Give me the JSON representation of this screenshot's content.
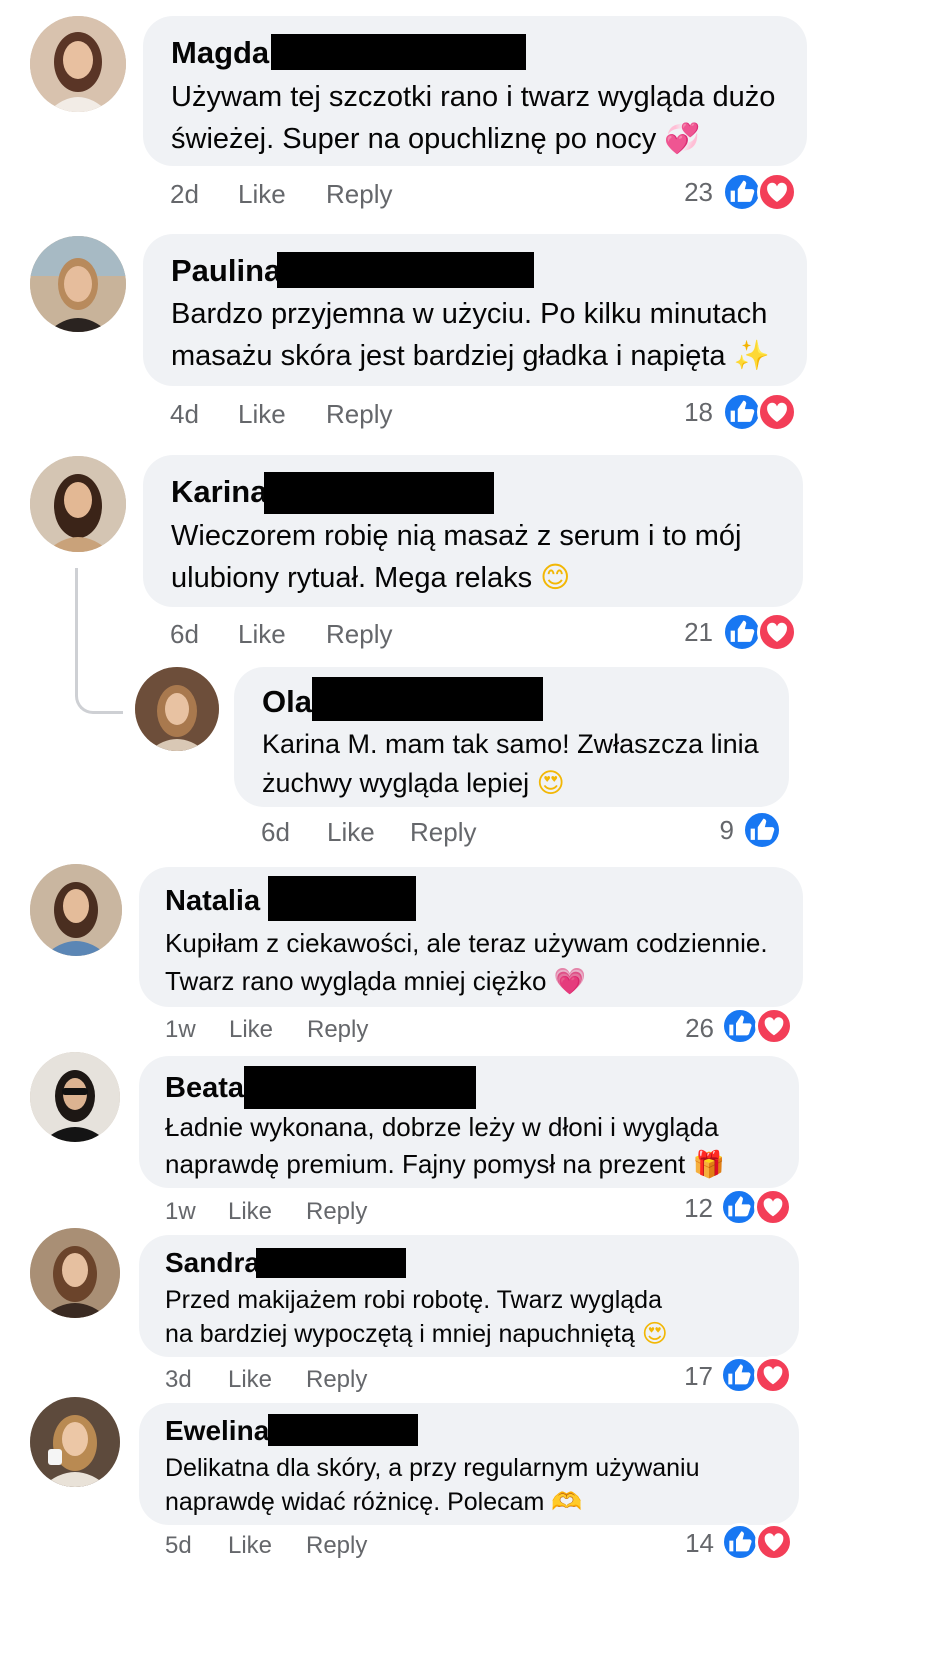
{
  "comments": [
    {
      "name": "Magda",
      "text_line1": "Używam tej szczotki rano i twarz wygląda dużo",
      "text_line2": "świeżej. Super na opuchliznę po nocy",
      "emoji": "💞",
      "emoji_name": "two-hearts-emoji",
      "time": "2d",
      "like": "Like",
      "reply": "Reply",
      "count": "23",
      "reactions": [
        "like",
        "love"
      ]
    },
    {
      "name": "Paulina",
      "text_line1": "Bardzo przyjemna w użyciu. Po kilku minutach",
      "text_line2": "masażu skóra jest bardziej gładka i napięta",
      "emoji": "✨",
      "emoji_name": "sparkles-emoji",
      "time": "4d",
      "like": "Like",
      "reply": "Reply",
      "count": "18",
      "reactions": [
        "like",
        "love"
      ]
    },
    {
      "name": "Karina",
      "text_line1": "Wieczorem robię nią masaż z serum i to mój",
      "text_line2": "ulubiony rytuał. Mega relaks",
      "emoji": "😊",
      "emoji_name": "smiling-face-emoji",
      "time": "6d",
      "like": "Like",
      "reply": "Reply",
      "count": "21",
      "reactions": [
        "like",
        "love"
      ]
    },
    {
      "name": "Ola",
      "text_line1": "Karina M. mam tak samo! Zwłaszcza linia",
      "text_line2": "żuchwy wygląda lepiej",
      "emoji": "😍",
      "emoji_name": "heart-eyes-emoji",
      "time": "6d",
      "like": "Like",
      "reply": "Reply",
      "count": "9",
      "reactions": [
        "like"
      ]
    },
    {
      "name": "Natalia",
      "text_line1": "Kupiłam z ciekawości, ale teraz używam codziennie.",
      "text_line2": "Twarz rano wygląda mniej ciężko",
      "emoji": "💗",
      "emoji_name": "growing-heart-emoji",
      "time": "1w",
      "like": "Like",
      "reply": "Reply",
      "count": "26",
      "reactions": [
        "like",
        "love"
      ]
    },
    {
      "name": "Beata",
      "text_line1": "Ładnie wykonana, dobrze leży w dłoni i wygląda",
      "text_line2": "naprawdę premium. Fajny pomysł na prezent",
      "emoji": "🎁",
      "emoji_name": "gift-emoji",
      "time": "1w",
      "like": "Like",
      "reply": "Reply",
      "count": "12",
      "reactions": [
        "like",
        "love"
      ]
    },
    {
      "name": "Sandra",
      "text_line1": "Przed makijażem robi robotę. Twarz wygląda",
      "text_line2": "na bardziej wypoczętą i mniej napuchniętą",
      "emoji": "😍",
      "emoji_name": "heart-eyes-emoji",
      "time": "3d",
      "like": "Like",
      "reply": "Reply",
      "count": "17",
      "reactions": [
        "like",
        "love"
      ]
    },
    {
      "name": "Ewelina",
      "text_line1": "Delikatna dla skóry, a przy regularnym używaniu",
      "text_line2": "naprawdę widać różnicę. Polecam",
      "emoji": "🫶",
      "emoji_name": "heart-hands-emoji",
      "time": "5d",
      "like": "Like",
      "reply": "Reply",
      "count": "14",
      "reactions": [
        "like",
        "love"
      ]
    }
  ],
  "colors": {
    "bubble": "#f0f2f5",
    "meta": "#65676b",
    "like_blue": "#1877f2",
    "love_red": "#f33e58",
    "redaction": "#000000"
  },
  "icons": {
    "like": "thumbs-up-icon",
    "love": "heart-icon"
  }
}
